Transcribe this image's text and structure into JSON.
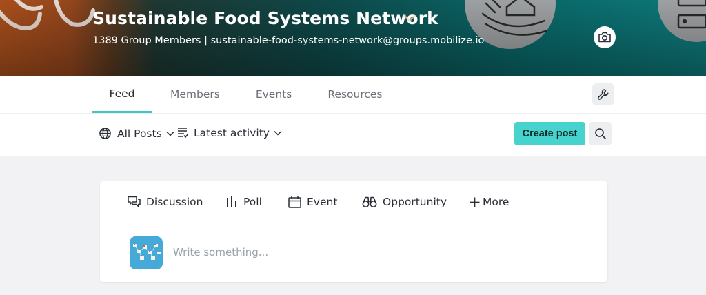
{
  "group": {
    "name": "Sustainable Food Systems Network",
    "member_count": "1389 Group Members",
    "separator": "|",
    "email": "sustainable-food-systems-network@groups.mobilize.io"
  },
  "tabs": [
    {
      "label": "Feed",
      "active": true
    },
    {
      "label": "Members",
      "active": false
    },
    {
      "label": "Events",
      "active": false
    },
    {
      "label": "Resources",
      "active": false
    }
  ],
  "filters": {
    "posts_label": "All Posts",
    "sort_label": "Latest activity"
  },
  "actions": {
    "create_post": "Create post"
  },
  "composer": {
    "types": [
      {
        "label": "Discussion",
        "icon": "discussion-icon"
      },
      {
        "label": "Poll",
        "icon": "poll-icon"
      },
      {
        "label": "Event",
        "icon": "calendar-icon"
      },
      {
        "label": "Opportunity",
        "icon": "binoculars-icon"
      },
      {
        "label": "More",
        "icon": "plus-icon"
      }
    ],
    "placeholder": "Write something..."
  },
  "colors": {
    "accent": "#47d3cd",
    "tab_underline": "#3fc4c4",
    "banner_teal": "#0a6d6e",
    "banner_orange": "#b2531d"
  }
}
